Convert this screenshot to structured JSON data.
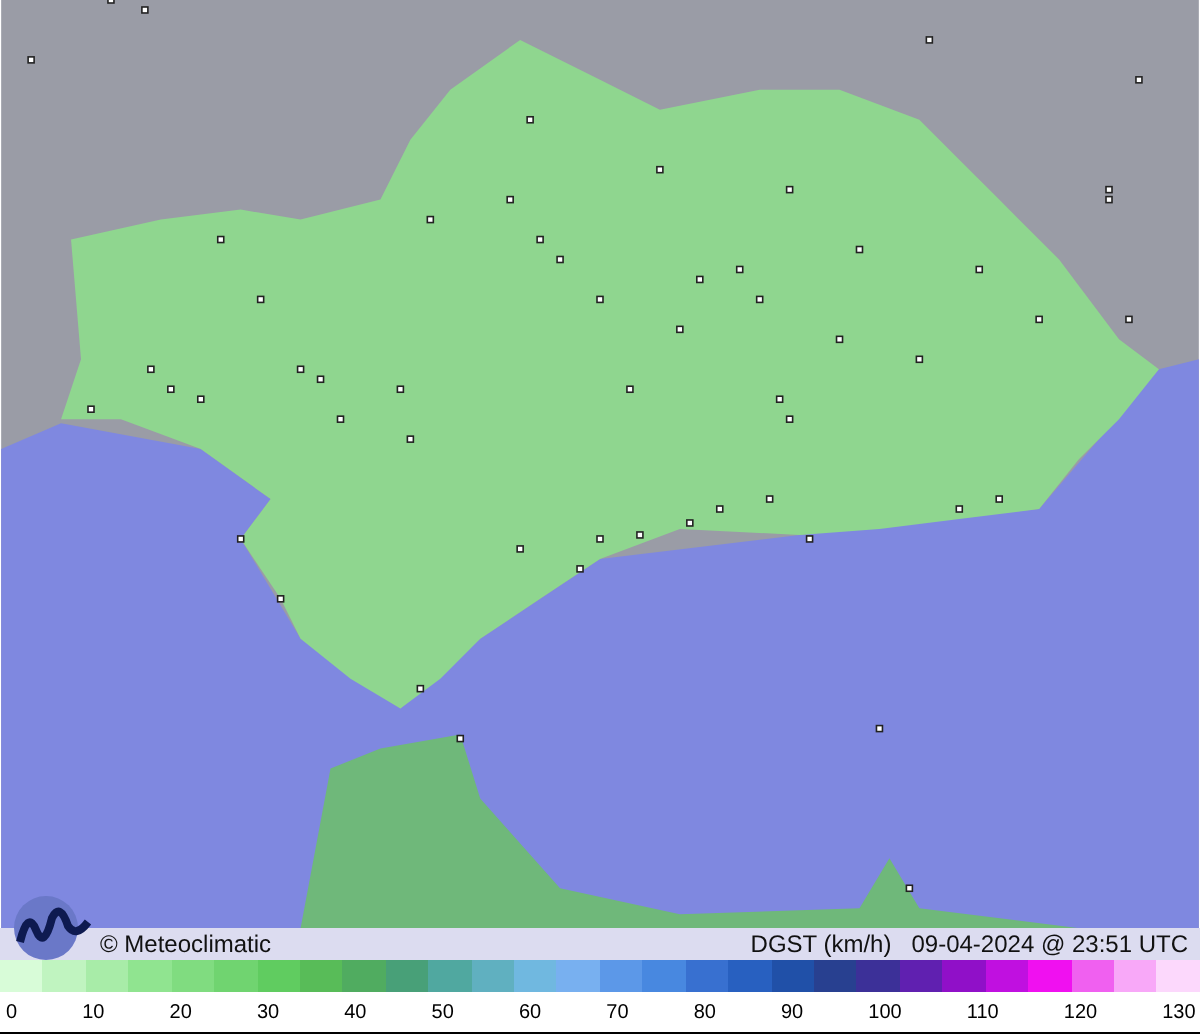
{
  "caption": {
    "credit": "© Meteoclimatic",
    "variable": "DGST (km/h)",
    "timestamp": "09-04-2024 @ 23:51 UTC"
  },
  "legend": {
    "ticks": [
      "0",
      "10",
      "20",
      "30",
      "40",
      "50",
      "60",
      "70",
      "80",
      "90",
      "100",
      "110",
      "120",
      "130"
    ]
  }
}
